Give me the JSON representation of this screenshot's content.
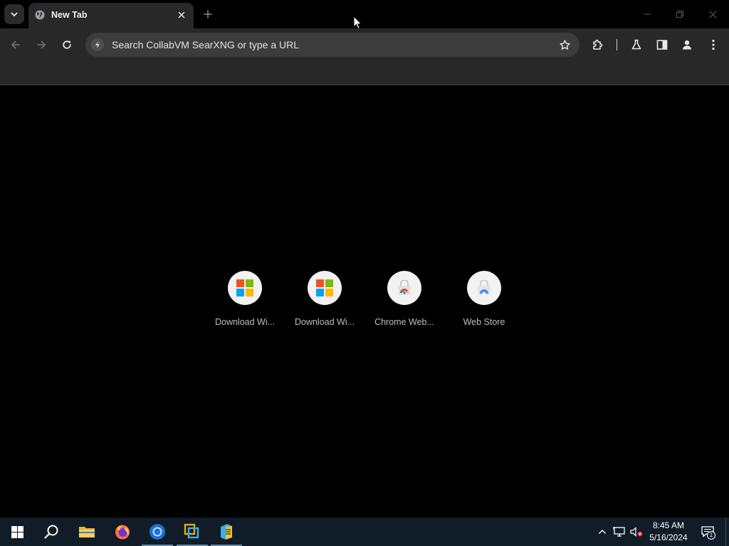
{
  "browser": {
    "tab": {
      "title": "New Tab"
    },
    "omnibox": {
      "placeholder": "Search CollabVM SearXNG or type a URL"
    }
  },
  "shortcuts": [
    {
      "label": "Download Wi...",
      "icon": "microsoft-logo-icon"
    },
    {
      "label": "Download Wi...",
      "icon": "microsoft-logo-icon"
    },
    {
      "label": "Chrome Web...",
      "icon": "chrome-web-store-icon"
    },
    {
      "label": "Web Store",
      "icon": "chrome-web-store-icon"
    }
  ],
  "taskbar": {
    "apps": [
      "start-icon",
      "search-icon",
      "file-explorer-icon",
      "firefox-icon",
      "chrome-icon",
      "vmware-icon",
      "app-icon"
    ],
    "clock": {
      "time": "8:45 AM",
      "date": "5/16/2024"
    },
    "notification_count": "1"
  },
  "colors": {
    "tab_bg": "#282828",
    "toolbar_bg": "#282828",
    "omnibox_bg": "#3c3c3c",
    "content_bg": "#000000",
    "taskbar_bg": "#101c28"
  }
}
